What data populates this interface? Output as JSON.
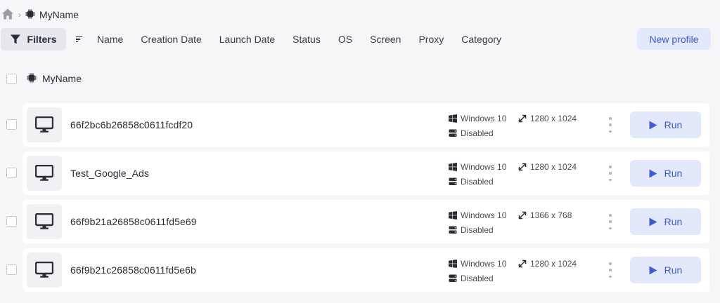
{
  "breadcrumb": {
    "current": "MyName"
  },
  "toolbar": {
    "filters_label": "Filters",
    "columns": [
      "Name",
      "Creation Date",
      "Launch Date",
      "Status",
      "OS",
      "Screen",
      "Proxy",
      "Category"
    ],
    "new_profile_label": "New profile"
  },
  "group": {
    "name": "MyName"
  },
  "profiles": [
    {
      "name": "66f2bc6b26858c0611fcdf20",
      "os": "Windows 10",
      "proxy": "Disabled",
      "screen": "1280 x 1024",
      "run_label": "Run"
    },
    {
      "name": "Test_Google_Ads",
      "os": "Windows 10",
      "proxy": "Disabled",
      "screen": "1280 x 1024",
      "run_label": "Run"
    },
    {
      "name": "66f9b21a26858c0611fd5e69",
      "os": "Windows 10",
      "proxy": "Disabled",
      "screen": "1366 x 768",
      "run_label": "Run"
    },
    {
      "name": "66f9b21c26858c0611fd5e6b",
      "os": "Windows 10",
      "proxy": "Disabled",
      "screen": "1280 x 1024",
      "run_label": "Run"
    }
  ],
  "colors": {
    "accent": "#3b5bdb",
    "accent_bg": "#e3e8fb",
    "page_bg": "#f6f6f8",
    "text": "#2a2c36"
  }
}
